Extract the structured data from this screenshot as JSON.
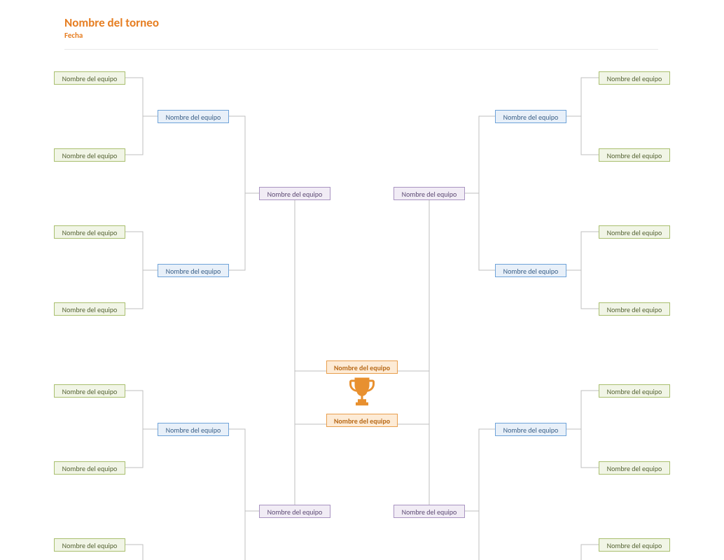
{
  "header": {
    "title": "Nombre del torneo",
    "date": "Fecha"
  },
  "labels": {
    "team": "Nombre del equipo"
  },
  "left": {
    "r1": [
      "Nombre del equipo",
      "Nombre del equipo",
      "Nombre del equipo",
      "Nombre del equipo",
      "Nombre del equipo",
      "Nombre del equipo",
      "Nombre del equipo"
    ],
    "r2": [
      "Nombre del equipo",
      "Nombre del equipo",
      "Nombre del equipo"
    ],
    "r3": [
      "Nombre del equipo",
      "Nombre del equipo"
    ]
  },
  "right": {
    "r1": [
      "Nombre del equipo",
      "Nombre del equipo",
      "Nombre del equipo",
      "Nombre del equipo",
      "Nombre del equipo",
      "Nombre del equipo",
      "Nombre del equipo"
    ],
    "r2": [
      "Nombre del equipo",
      "Nombre del equipo",
      "Nombre del equipo"
    ],
    "r3": [
      "Nombre del equipo",
      "Nombre del equipo"
    ]
  },
  "finals": {
    "top": "Nombre del equipo",
    "bottom": "Nombre del equipo"
  }
}
